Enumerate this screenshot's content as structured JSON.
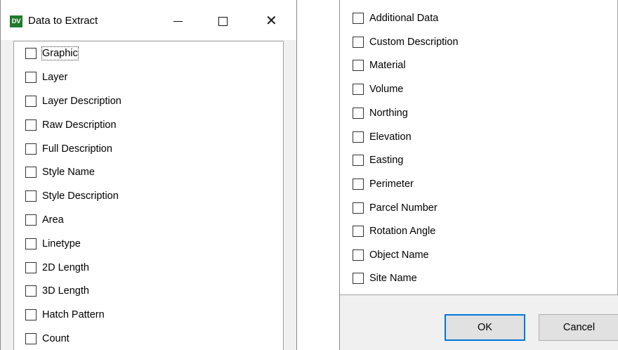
{
  "window": {
    "app_icon_text": "DV",
    "title": "Data to Extract"
  },
  "left_list": [
    {
      "label": "Graphic",
      "checked": false,
      "focused": true
    },
    {
      "label": "Layer",
      "checked": false
    },
    {
      "label": "Layer Description",
      "checked": false
    },
    {
      "label": "Raw Description",
      "checked": false
    },
    {
      "label": "Full Description",
      "checked": false
    },
    {
      "label": "Style Name",
      "checked": false
    },
    {
      "label": "Style Description",
      "checked": false
    },
    {
      "label": "Area",
      "checked": false
    },
    {
      "label": "Linetype",
      "checked": false
    },
    {
      "label": "2D Length",
      "checked": false
    },
    {
      "label": "3D Length",
      "checked": false
    },
    {
      "label": "Hatch Pattern",
      "checked": false
    },
    {
      "label": "Count",
      "checked": false
    }
  ],
  "right_list": [
    {
      "label": "Additional Data",
      "checked": false
    },
    {
      "label": "Custom Description",
      "checked": false
    },
    {
      "label": "Material",
      "checked": false
    },
    {
      "label": "Volume",
      "checked": false
    },
    {
      "label": "Northing",
      "checked": false
    },
    {
      "label": "Elevation",
      "checked": false
    },
    {
      "label": "Easting",
      "checked": false
    },
    {
      "label": "Perimeter",
      "checked": false
    },
    {
      "label": "Parcel Number",
      "checked": false
    },
    {
      "label": "Rotation Angle",
      "checked": false
    },
    {
      "label": "Object Name",
      "checked": false
    },
    {
      "label": "Site Name",
      "checked": false
    }
  ],
  "buttons": {
    "ok": "OK",
    "cancel": "Cancel"
  }
}
